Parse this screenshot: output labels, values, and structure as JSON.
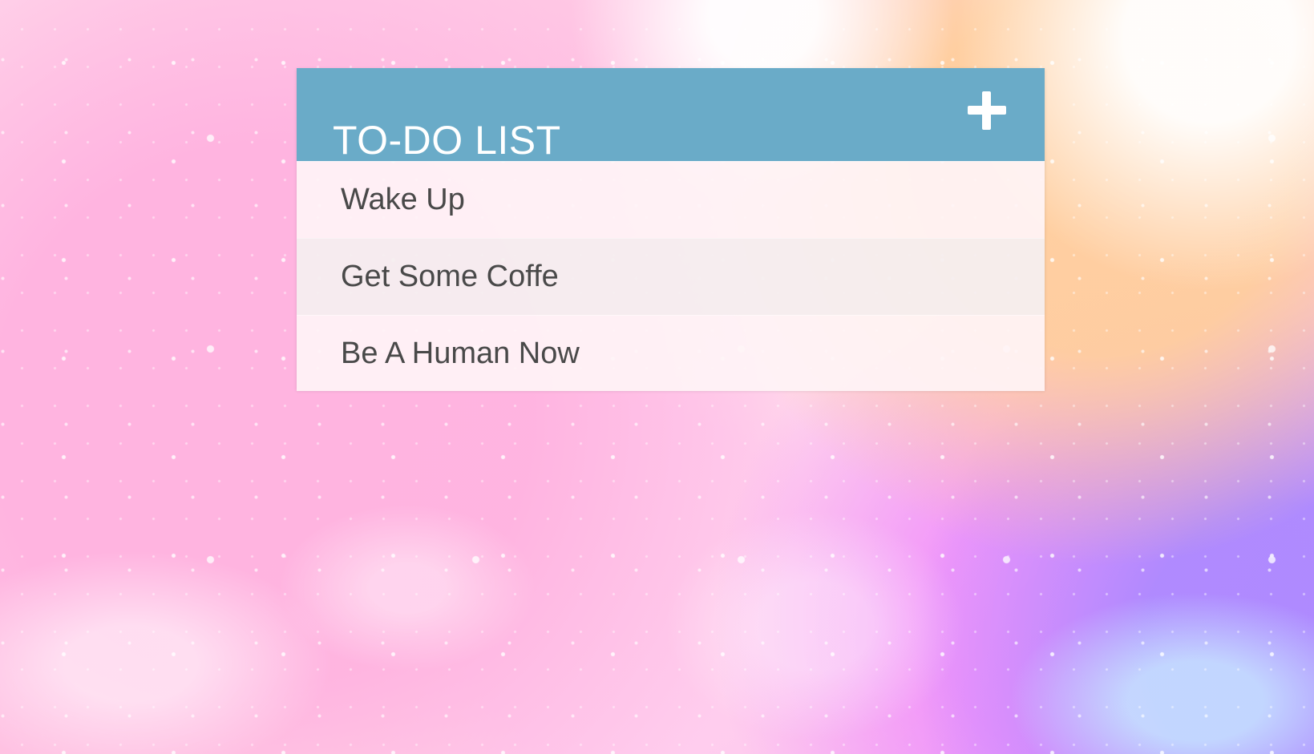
{
  "todo": {
    "title": "TO-DO LIST",
    "add_icon": "plus-icon",
    "items": [
      {
        "label": "Wake Up"
      },
      {
        "label": "Get Some Coffe"
      },
      {
        "label": "Be A Human Now"
      }
    ]
  },
  "colors": {
    "header": "#6aabc8",
    "list_background": "#fff4f6",
    "list_alternate": "#f6eeef",
    "text": "#494949",
    "background_pink": "#ffc7e4",
    "background_peach": "#ffce9d",
    "background_purple": "#a989ff"
  }
}
